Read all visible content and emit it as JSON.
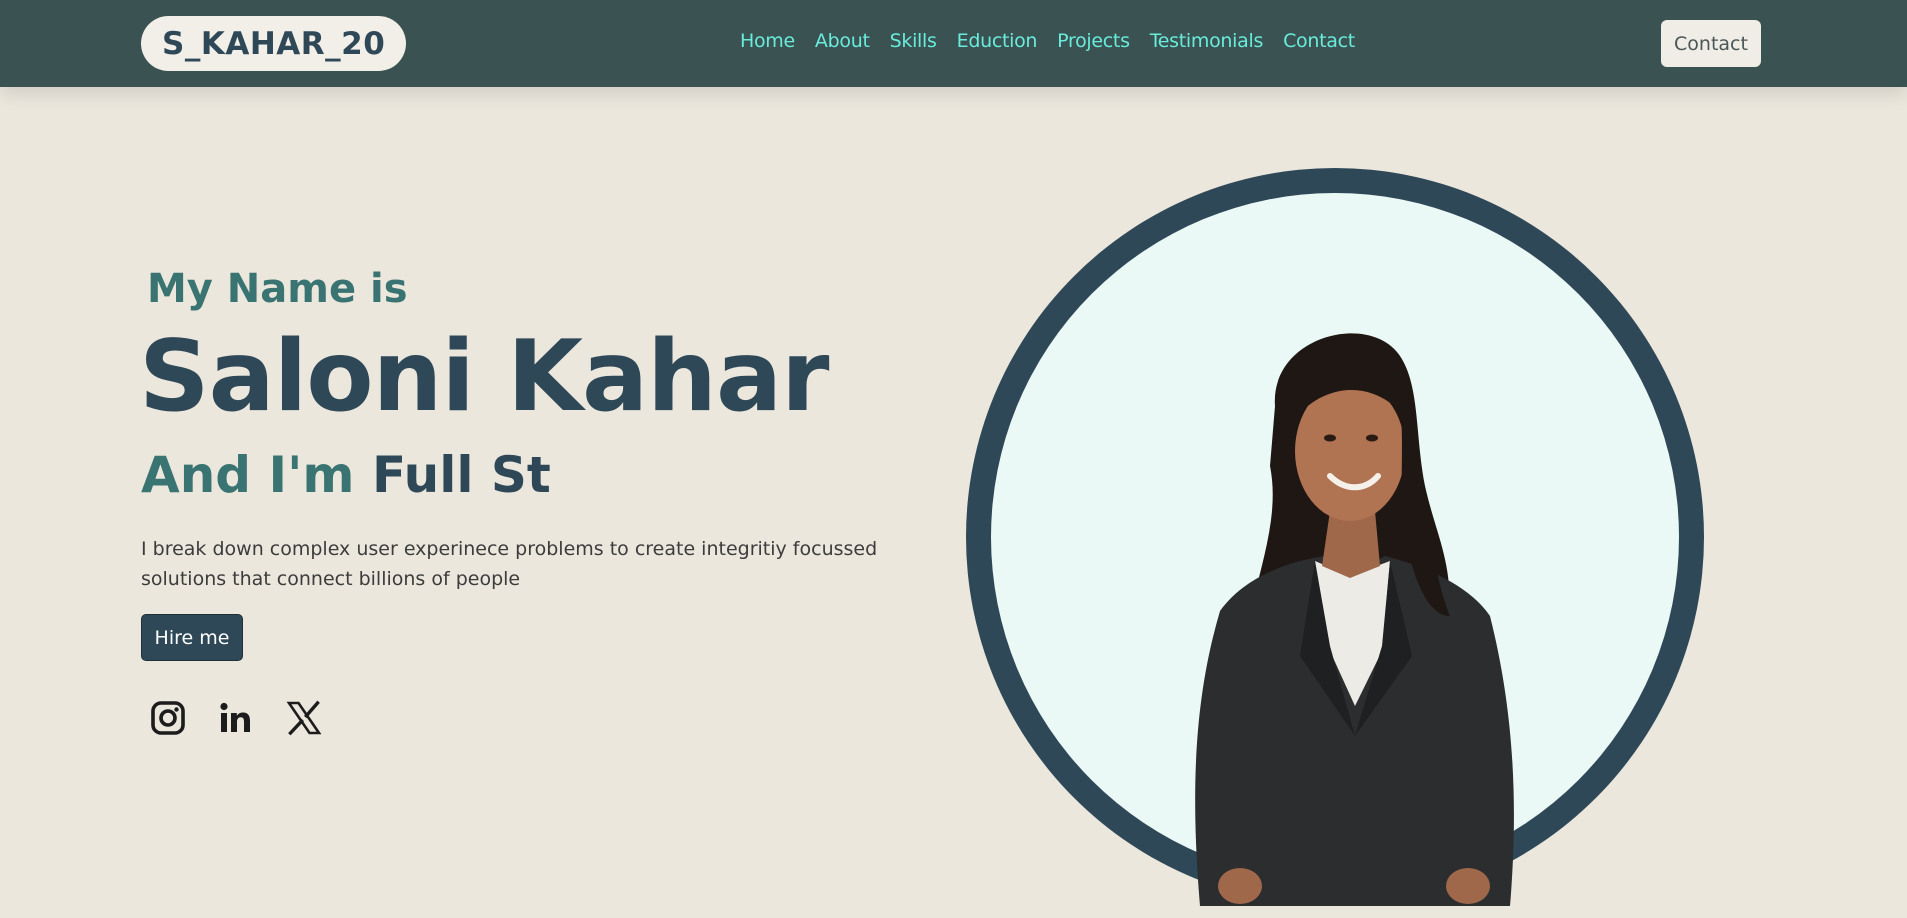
{
  "nav": {
    "brand": "S_KAHAR_20",
    "links": [
      "Home",
      "About",
      "Skills",
      "Eduction",
      "Projects",
      "Testimonials",
      "Contact"
    ],
    "contact_button": "Contact"
  },
  "hero": {
    "intro": "My Name is",
    "name": "Saloni Kahar",
    "role_prefix": "And I'm",
    "role_typed": "Full St",
    "description": "I break down complex user experinece problems to create integritiy focussed solutions that connect billions of people",
    "hire_button": "Hire me",
    "socials": [
      "instagram-icon",
      "linkedin-icon",
      "x-icon"
    ]
  },
  "colors": {
    "navbar": "#3b5252",
    "background": "#ebe7dd",
    "accent_teal": "#3a7472",
    "primary_dark": "#2f4858",
    "nav_link": "#69ecdc",
    "photo_circle": "#eaf9f6"
  }
}
